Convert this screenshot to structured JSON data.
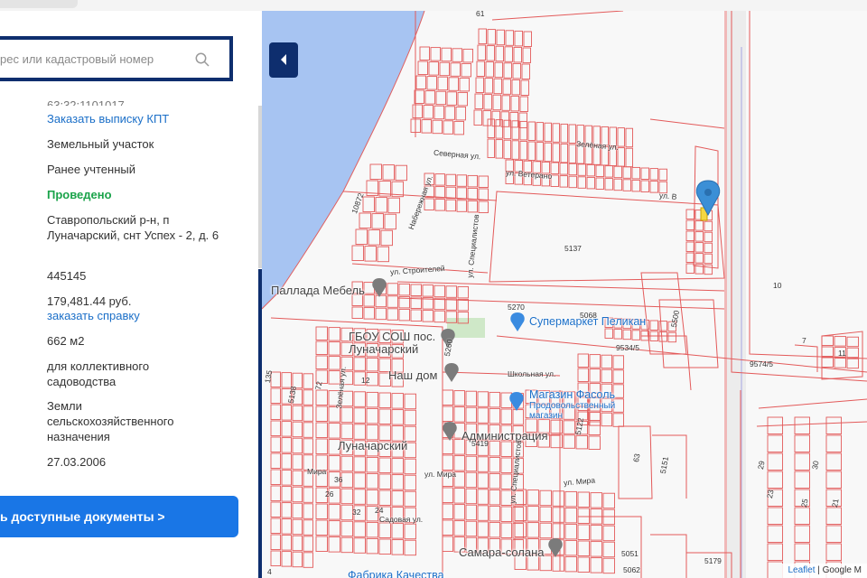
{
  "search": {
    "placeholder": "рес или кадастровый номер"
  },
  "details": {
    "cut_number": "63:32:1101017",
    "kpt_link": "Заказать выписку КПТ",
    "object_type": "Земельный участок",
    "status": "Ранее учтенный",
    "registration": "Проведено",
    "address": "Ставропольский р-н, п Луначарский, снт Успех - 2, д. 6",
    "postal_code": "445145",
    "cadastral_cost": "179,481.44 руб.",
    "cost_link": "заказать справку",
    "area": "662 м2",
    "usage": "для коллективного садоводства",
    "category": "Земли сельскохозяйственного назначения",
    "date": "27.03.2006"
  },
  "docs_button": "ь доступные документы >",
  "map": {
    "labels": {
      "lunacharsky": "Луначарский",
      "pallada": "Паллада Мебель",
      "school": "ГБОУ СОШ пос. Луначарский",
      "nash_dom": "Наш дом",
      "pelican": "Супермаркет Пеликан",
      "fasol": "Магазин Фасоль",
      "fasol_sub": "Продовольственный магазин",
      "administration": "Администрация",
      "samara_solana": "Самара-солана",
      "fabrika": "Фабрика Качества"
    },
    "streets": {
      "severnaya": "Северная ул.",
      "zelenaya": "Зелёная ул.",
      "ul_r": "ул. Ветерано",
      "ul_r2": "ул. В",
      "stroiteley": "ул. Строителей",
      "shkolnaya": "Школьная ул.",
      "mira": "ул. Мира",
      "mira2": "ул. Мира",
      "mira3": "Мира",
      "sadovaya": "Садовая ул.",
      "specialistov": "ул. Специалистов",
      "specialistov2": "ул. Специалистов",
      "zelenaya_v": "Зелёная ул.",
      "naberezhnaya": "Набережная ул."
    },
    "numbers": [
      "61",
      "10872",
      "5137",
      "5270",
      "5068",
      "5500",
      "10",
      "9534/5",
      "9574/5",
      "7",
      "11",
      "5260",
      "5122",
      "5138",
      "72",
      "36",
      "32",
      "24",
      "5419",
      "63",
      "5151",
      "23",
      "25",
      "21",
      "5051",
      "5062",
      "5179",
      "135",
      "12",
      "4",
      "29",
      "30",
      "26"
    ],
    "attribution": {
      "leaflet": "Leaflet",
      "sep": " | ",
      "google": "Google M"
    }
  }
}
